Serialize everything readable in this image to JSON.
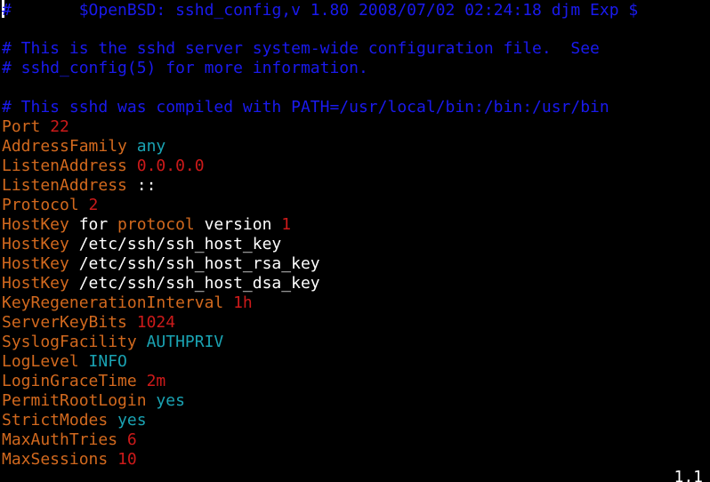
{
  "colors": {
    "background": "#000000",
    "comment": "#1a1aee",
    "keyword": "#d2691e",
    "number": "#cc1a1a",
    "constant": "#1aa3b3",
    "plain": "#ffffff",
    "cursor": "#ffffff"
  },
  "lines": [
    [
      {
        "t": "#\t$OpenBSD: sshd_config,v 1.80 2008/07/02 02:24:18 djm Exp $",
        "c": "comment"
      }
    ],
    [],
    [
      {
        "t": "# This is the sshd server system-wide configuration file.  See",
        "c": "comment"
      }
    ],
    [
      {
        "t": "# sshd_config(5) for more information.",
        "c": "comment"
      }
    ],
    [],
    [
      {
        "t": "# This sshd was compiled with PATH=/usr/local/bin:/bin:/usr/bin",
        "c": "comment"
      }
    ],
    [
      {
        "t": "Port",
        "c": "keyword"
      },
      {
        "t": " ",
        "c": "plain"
      },
      {
        "t": "22",
        "c": "number"
      }
    ],
    [
      {
        "t": "AddressFamily",
        "c": "keyword"
      },
      {
        "t": " ",
        "c": "plain"
      },
      {
        "t": "any",
        "c": "constant"
      }
    ],
    [
      {
        "t": "ListenAddress",
        "c": "keyword"
      },
      {
        "t": " ",
        "c": "plain"
      },
      {
        "t": "0.0.0.0",
        "c": "number"
      }
    ],
    [
      {
        "t": "ListenAddress",
        "c": "keyword"
      },
      {
        "t": " ::",
        "c": "plain"
      }
    ],
    [
      {
        "t": "Protocol",
        "c": "keyword"
      },
      {
        "t": " ",
        "c": "plain"
      },
      {
        "t": "2",
        "c": "number"
      }
    ],
    [
      {
        "t": "HostKey",
        "c": "keyword"
      },
      {
        "t": " for ",
        "c": "plain"
      },
      {
        "t": "protocol",
        "c": "keyword"
      },
      {
        "t": " version ",
        "c": "plain"
      },
      {
        "t": "1",
        "c": "number"
      }
    ],
    [
      {
        "t": "HostKey",
        "c": "keyword"
      },
      {
        "t": " /etc/ssh/ssh_host_key",
        "c": "plain"
      }
    ],
    [
      {
        "t": "HostKey",
        "c": "keyword"
      },
      {
        "t": " /etc/ssh/ssh_host_rsa_key",
        "c": "plain"
      }
    ],
    [
      {
        "t": "HostKey",
        "c": "keyword"
      },
      {
        "t": " /etc/ssh/ssh_host_dsa_key",
        "c": "plain"
      }
    ],
    [
      {
        "t": "KeyRegenerationInterval",
        "c": "keyword"
      },
      {
        "t": " ",
        "c": "plain"
      },
      {
        "t": "1h",
        "c": "number"
      }
    ],
    [
      {
        "t": "ServerKeyBits",
        "c": "keyword"
      },
      {
        "t": " ",
        "c": "plain"
      },
      {
        "t": "1024",
        "c": "number"
      }
    ],
    [
      {
        "t": "SyslogFacility",
        "c": "keyword"
      },
      {
        "t": " ",
        "c": "plain"
      },
      {
        "t": "AUTHPRIV",
        "c": "constant"
      }
    ],
    [
      {
        "t": "LogLevel",
        "c": "keyword"
      },
      {
        "t": " ",
        "c": "plain"
      },
      {
        "t": "INFO",
        "c": "constant"
      }
    ],
    [
      {
        "t": "LoginGraceTime",
        "c": "keyword"
      },
      {
        "t": " ",
        "c": "plain"
      },
      {
        "t": "2m",
        "c": "number"
      }
    ],
    [
      {
        "t": "PermitRootLogin",
        "c": "keyword"
      },
      {
        "t": " ",
        "c": "plain"
      },
      {
        "t": "yes",
        "c": "constant"
      }
    ],
    [
      {
        "t": "StrictModes",
        "c": "keyword"
      },
      {
        "t": " ",
        "c": "plain"
      },
      {
        "t": "yes",
        "c": "constant"
      }
    ],
    [
      {
        "t": "MaxAuthTries",
        "c": "keyword"
      },
      {
        "t": " ",
        "c": "plain"
      },
      {
        "t": "6",
        "c": "number"
      }
    ],
    [
      {
        "t": "MaxSessions",
        "c": "keyword"
      },
      {
        "t": " ",
        "c": "plain"
      },
      {
        "t": "10",
        "c": "number"
      }
    ]
  ],
  "ruler": "1,1"
}
